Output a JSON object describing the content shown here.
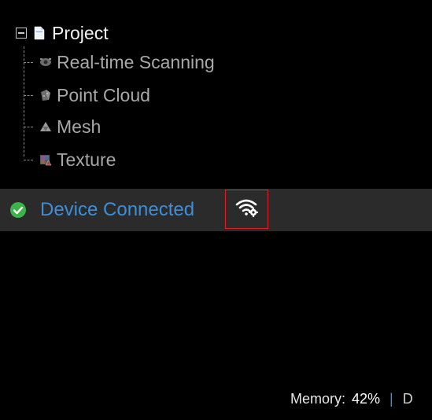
{
  "tree": {
    "root": {
      "label": "Project",
      "expander_icon": "collapse-minus-icon",
      "icon": "document-icon"
    },
    "children": [
      {
        "label": "Real-time Scanning",
        "icon": "scanner-icon"
      },
      {
        "label": "Point Cloud",
        "icon": "point-cloud-icon"
      },
      {
        "label": "Mesh",
        "icon": "mesh-icon"
      },
      {
        "label": "Texture",
        "icon": "texture-icon"
      }
    ]
  },
  "statusbar": {
    "connection_status": "Device Connected",
    "connection_icon": "check-circle-icon",
    "wifi_icon": "wifi-settings-icon",
    "memory_label": "Memory:",
    "memory_value": "42%",
    "separator": "|",
    "truncated_text": "D"
  },
  "colors": {
    "background": "#000000",
    "statusbar_bg": "#2b2b2b",
    "accent_blue": "#3d8ed8",
    "success_green": "#3bb54a",
    "highlight_red": "#e0202a"
  }
}
